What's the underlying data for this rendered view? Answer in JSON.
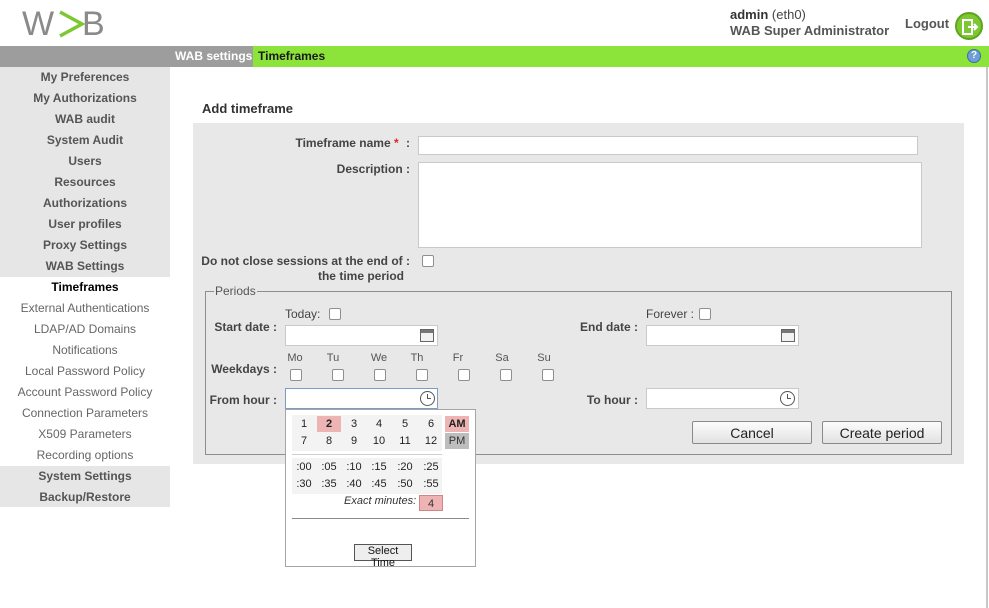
{
  "header": {
    "logo_text": "WAB",
    "user_name": "admin",
    "interface": "(eth0)",
    "role": "WAB Super Administrator",
    "logout_label": "Logout"
  },
  "breadcrumb": {
    "section": "WAB settings",
    "current": "Timeframes",
    "help": "?"
  },
  "sidebar": {
    "items": [
      {
        "label": "My Preferences"
      },
      {
        "label": "My Authorizations"
      },
      {
        "label": "WAB audit"
      },
      {
        "label": "System Audit"
      },
      {
        "label": "Users"
      },
      {
        "label": "Resources"
      },
      {
        "label": "Authorizations"
      },
      {
        "label": "User profiles"
      },
      {
        "label": "Proxy Settings"
      },
      {
        "label": "WAB Settings"
      }
    ],
    "subitems": [
      {
        "label": "Timeframes"
      },
      {
        "label": "External Authentications"
      },
      {
        "label": "LDAP/AD Domains"
      },
      {
        "label": "Notifications"
      },
      {
        "label": "Local Password Policy"
      },
      {
        "label": "Account Password Policy"
      },
      {
        "label": "Connection Parameters"
      },
      {
        "label": "X509 Parameters"
      },
      {
        "label": "Recording options"
      }
    ],
    "bottom_items": [
      {
        "label": "System Settings"
      },
      {
        "label": "Backup/Restore"
      }
    ]
  },
  "form": {
    "title": "Add timeframe",
    "name_label": "Timeframe name",
    "required_mark": "*",
    "colon": ":",
    "name_value": "",
    "description_label": "Description :",
    "description_value": "",
    "no_close_label_line1": "Do not close sessions at the end of :",
    "no_close_label_line2": "the time period",
    "periods_legend": "Periods",
    "today_label": "Today:",
    "forever_label": "Forever :",
    "start_date_label": "Start date :",
    "end_date_label": "End date :",
    "start_date_value": "",
    "end_date_value": "",
    "weekdays_label": "Weekdays :",
    "weekdays": [
      "Mo",
      "Tu",
      "We",
      "Th",
      "Fr",
      "Sa",
      "Su"
    ],
    "from_hour_label": "From hour :",
    "to_hour_label": "To hour :",
    "from_hour_value": "",
    "to_hour_value": "",
    "cancel_label": "Cancel",
    "create_label": "Create period"
  },
  "time_picker": {
    "hours_row1": [
      "1",
      "2",
      "3",
      "4",
      "5",
      "6"
    ],
    "hours_row2": [
      "7",
      "8",
      "9",
      "10",
      "11",
      "12"
    ],
    "selected_hour": "2",
    "am": "AM",
    "pm": "PM",
    "selected_period": "AM",
    "minutes_row1": [
      ":00",
      ":05",
      ":10",
      ":15",
      ":20",
      ":25"
    ],
    "minutes_row2": [
      ":30",
      ":35",
      ":40",
      ":45",
      ":50",
      ":55"
    ],
    "exact_minutes_label": "Exact minutes:",
    "exact_minutes_value": "4",
    "select_button": "Select Time"
  }
}
